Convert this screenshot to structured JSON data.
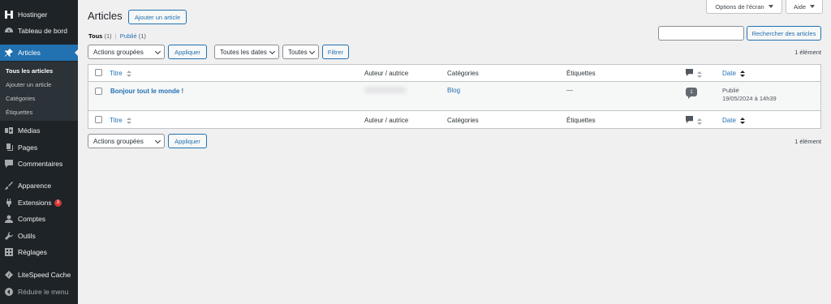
{
  "sidebar": {
    "items": [
      {
        "label": "Hostinger",
        "icon": "hostinger-logo-icon"
      },
      {
        "label": "Tableau de bord",
        "icon": "dashboard-icon"
      },
      {
        "label": "Articles",
        "icon": "pin-icon"
      },
      {
        "label": "Médias",
        "icon": "media-icon"
      },
      {
        "label": "Pages",
        "icon": "pages-icon"
      },
      {
        "label": "Commentaires",
        "icon": "comments-icon"
      },
      {
        "label": "Apparence",
        "icon": "brush-icon"
      },
      {
        "label": "Extensions",
        "icon": "plugin-icon",
        "badge": "3"
      },
      {
        "label": "Comptes",
        "icon": "users-icon"
      },
      {
        "label": "Outils",
        "icon": "wrench-icon"
      },
      {
        "label": "Réglages",
        "icon": "settings-icon"
      },
      {
        "label": "LiteSpeed Cache",
        "icon": "litespeed-icon"
      }
    ],
    "submenu": [
      "Tous les articles",
      "Ajouter un article",
      "Catégories",
      "Étiquettes"
    ],
    "collapse_label": "Réduire le menu",
    "accent": "#2271b1"
  },
  "header": {
    "title": "Articles",
    "add_button": "Ajouter un article",
    "screen_options": "Options de l'écran",
    "help": "Aide"
  },
  "filters": {
    "all_label": "Tous",
    "all_count": "(1)",
    "separator": "|",
    "published_label": "Publié",
    "published_count": "(1)",
    "search_button": "Rechercher des articles",
    "bulk_actions": "Actions groupées",
    "apply": "Appliquer",
    "dates": "Toutes les dates",
    "categories": "Toutes",
    "filter_button": "Filtrer",
    "count": "1 élément"
  },
  "table": {
    "columns": {
      "title": "Titre",
      "author": "Auteur / autrice",
      "categories": "Catégories",
      "tags": "Étiquettes",
      "date": "Date"
    },
    "rows": [
      {
        "title": "Bonjour tout le monde !",
        "category": "Blog",
        "tags": "—",
        "comments": "1",
        "status": "Publié",
        "date": "19/05/2024 à 14h39"
      }
    ]
  },
  "bottom": {
    "bulk_actions": "Actions groupées",
    "apply": "Appliquer",
    "count": "1 élément"
  }
}
